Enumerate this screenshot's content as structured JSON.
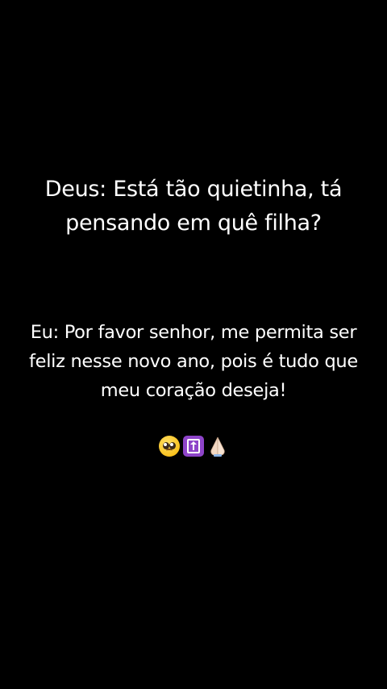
{
  "message": {
    "deus": "Deus: Está tão quietinha, tá\npensando em quê filha?",
    "eu": "Eu: Por favor senhor, me permita ser\nfeliz nesse novo ano, pois é tudo que\nmeu coração deseja!"
  },
  "emojis": [
    "pleading-face",
    "elevator",
    "folded-hands"
  ],
  "colors": {
    "background": "#000000",
    "text": "#ffffff"
  }
}
